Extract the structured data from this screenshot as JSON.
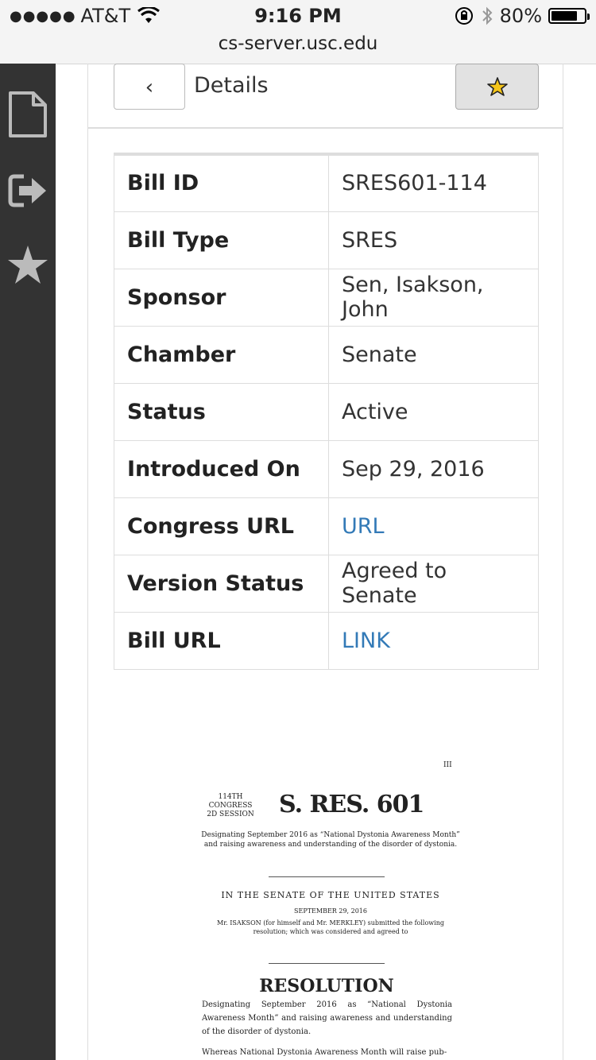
{
  "status_bar": {
    "signal_dots": "●●●●●",
    "carrier": "AT&T",
    "time": "9:16 PM",
    "battery_pct": "80%",
    "battery_level": 0.8
  },
  "browser": {
    "url": "cs-server.usc.edu"
  },
  "sidebar": {
    "items": [
      {
        "icon": "document-icon"
      },
      {
        "icon": "sign-out-icon"
      },
      {
        "icon": "star-icon"
      }
    ]
  },
  "header": {
    "back_label": "‹",
    "title": "Details",
    "favorite_icon": "star-icon",
    "favorite_color": "#f5c518"
  },
  "details": {
    "rows": [
      {
        "label": "Bill ID",
        "value": "SRES601-114"
      },
      {
        "label": "Bill Type",
        "value": "SRES"
      },
      {
        "label": "Sponsor",
        "value": "Sen, Isakson, John"
      },
      {
        "label": "Chamber",
        "value": "Senate"
      },
      {
        "label": "Status",
        "value": "Active"
      },
      {
        "label": "Introduced On",
        "value": "Sep 29, 2016"
      },
      {
        "label": "Congress URL",
        "value": "URL"
      },
      {
        "label": "Version Status",
        "value": "Agreed to Senate"
      },
      {
        "label": "Bill URL",
        "value": "LINK"
      }
    ],
    "link_color": "#337ab7"
  },
  "document": {
    "roman": "III",
    "congress_line1": "114TH CONGRESS",
    "congress_line2": "2D SESSION",
    "res_number": "S. RES. 601",
    "designation_top": "Designating September 2016 as “National Dystonia Awareness Month” and raising awareness and understanding of the disorder of dystonia.",
    "senate_heading": "IN THE SENATE OF THE UNITED STATES",
    "senate_date": "SEPTEMBER 29, 2016",
    "submitted": "Mr. ISAKSON (for himself and Mr. MERKLEY) submitted the following resolution; which was considered and agreed to",
    "resolution_heading": "RESOLUTION",
    "designation_body": "Designating September 2016 as “National Dystonia Awareness Month” and raising awareness and understanding of the disorder of dystonia.",
    "whereas": "Whereas National Dystonia Awareness Month will raise pub-"
  }
}
